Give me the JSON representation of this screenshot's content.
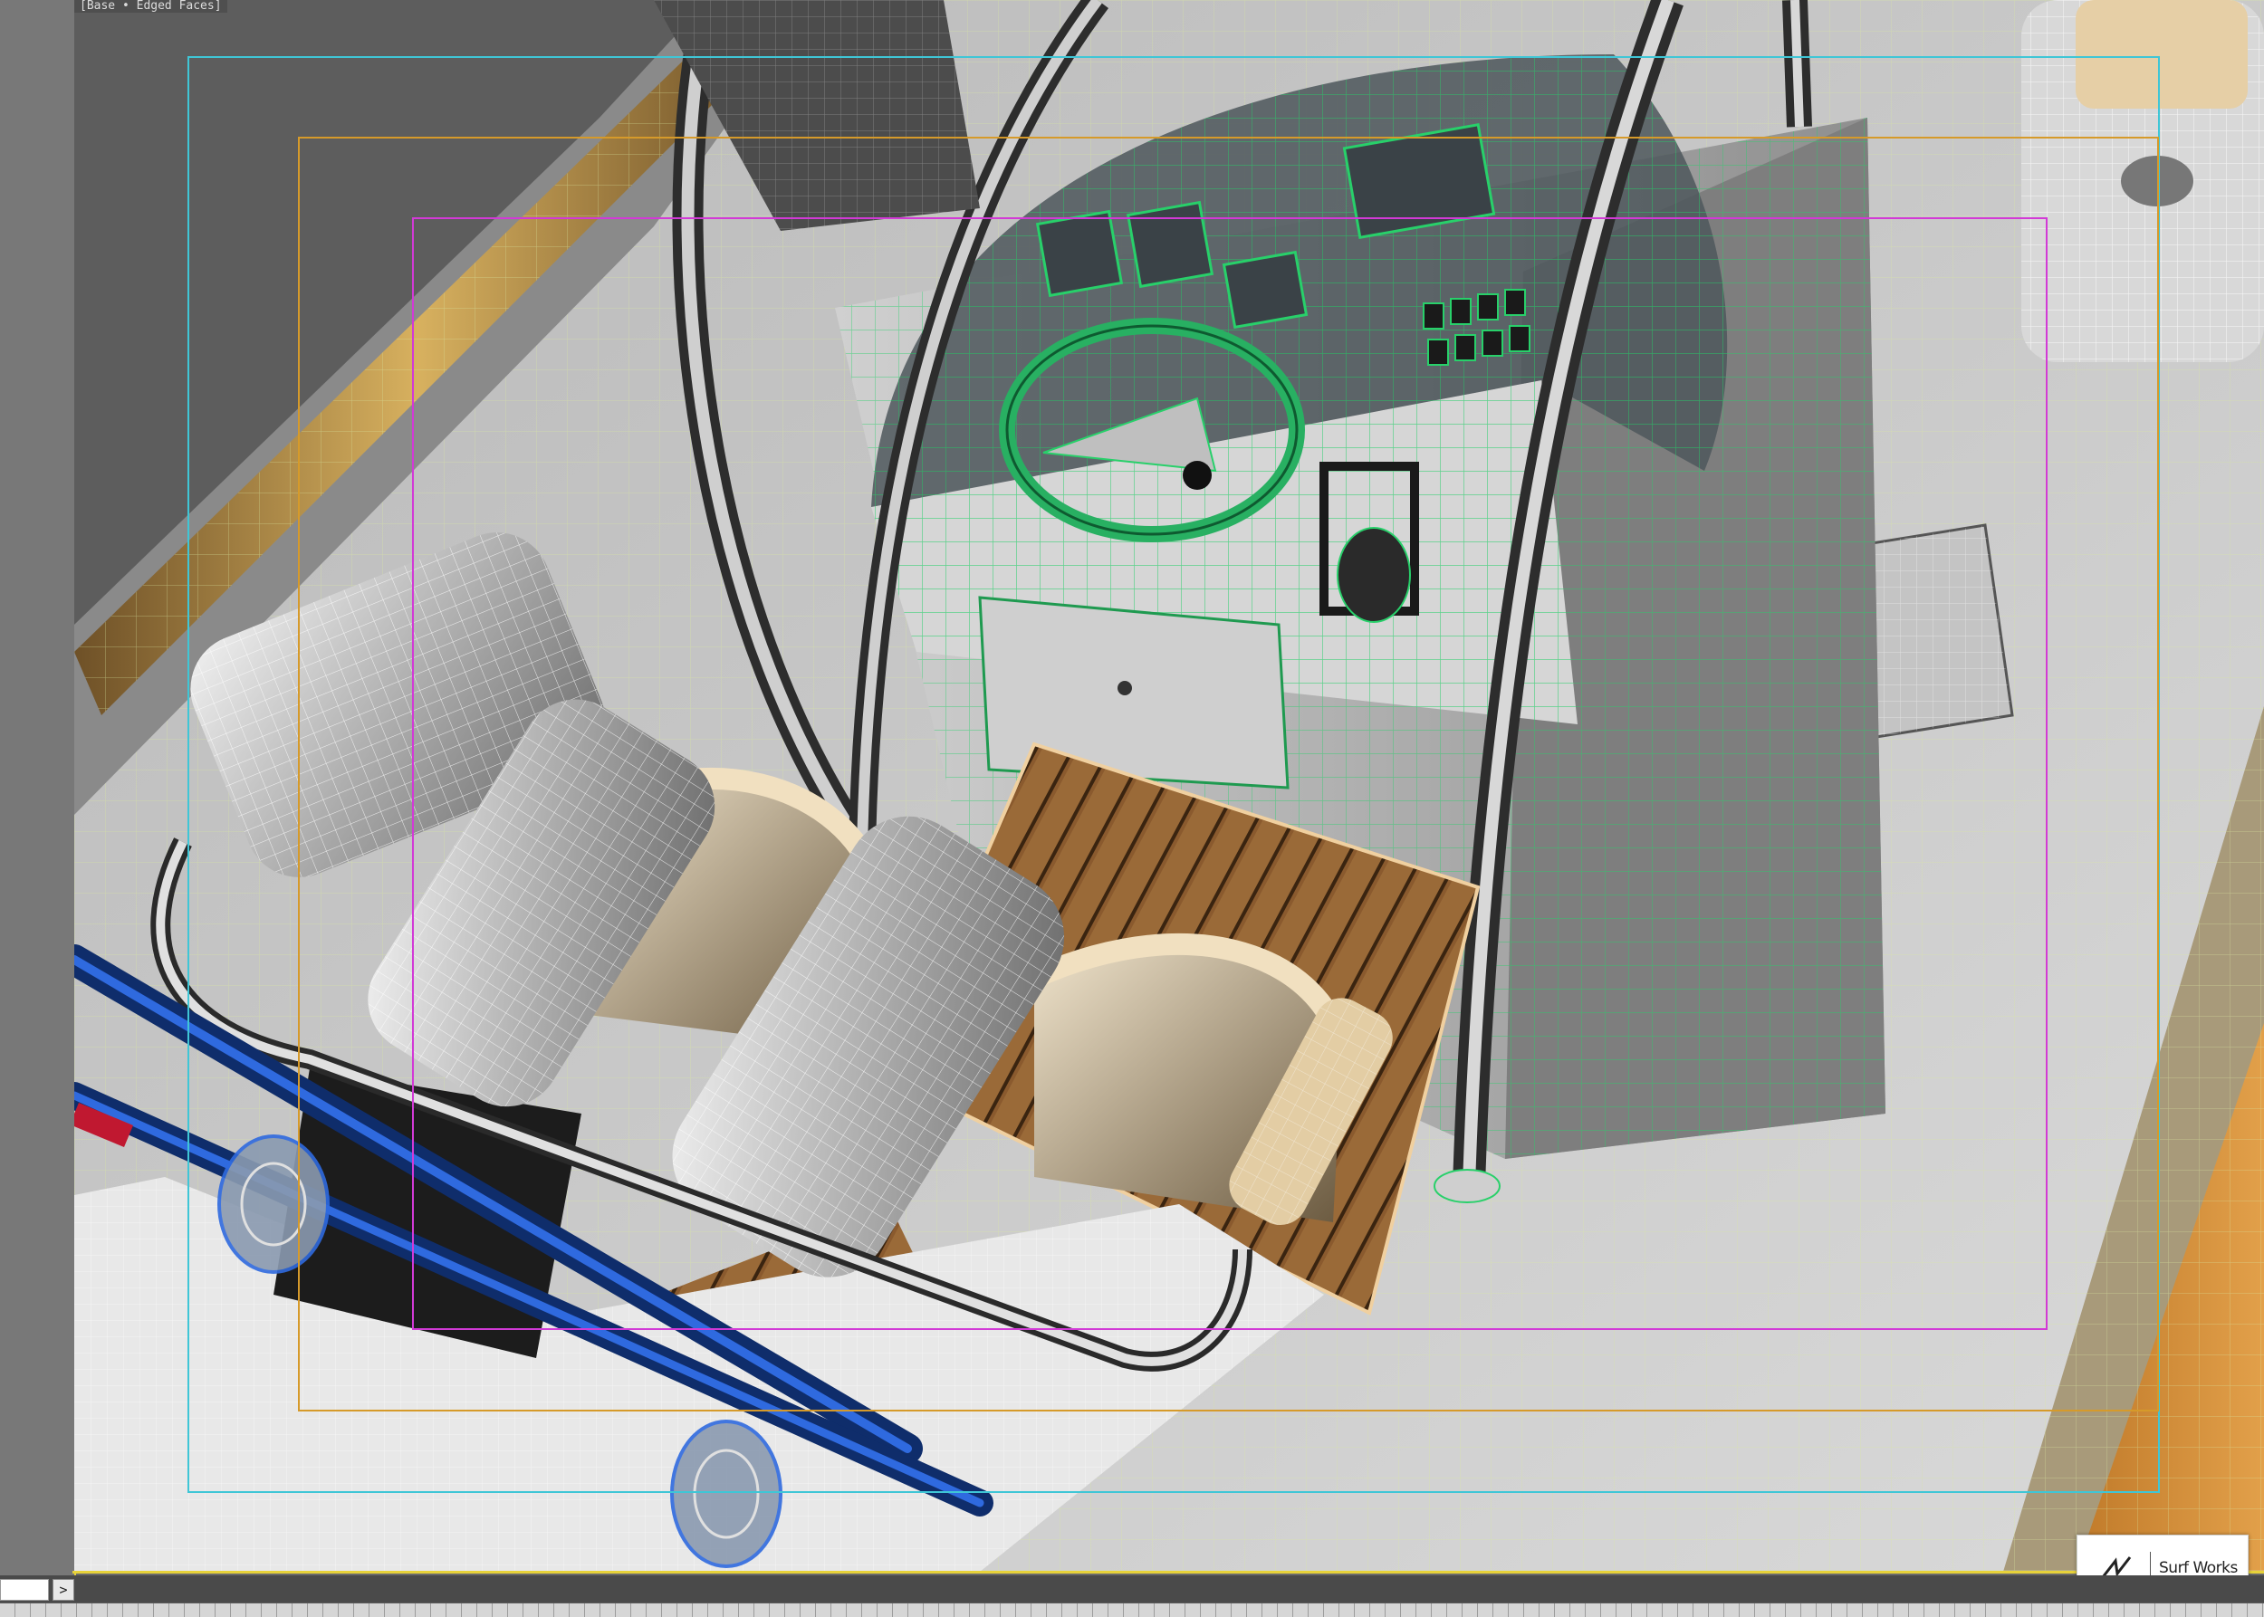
{
  "viewport": {
    "label": "[Base • Edged Faces]",
    "name": "3d-perspective-viewport"
  },
  "command": {
    "value": "",
    "arrow": ">"
  },
  "watermark": {
    "text": "Surf Works"
  },
  "colors": {
    "viewport_border": "#e7d23a",
    "safe_frame_outer": "#3fc6d6",
    "safe_frame_action": "#d69a2a",
    "safe_frame_title": "#d23ad6",
    "console_wire": "#1fbf5a",
    "deck_teak": "#8a5a2e"
  }
}
